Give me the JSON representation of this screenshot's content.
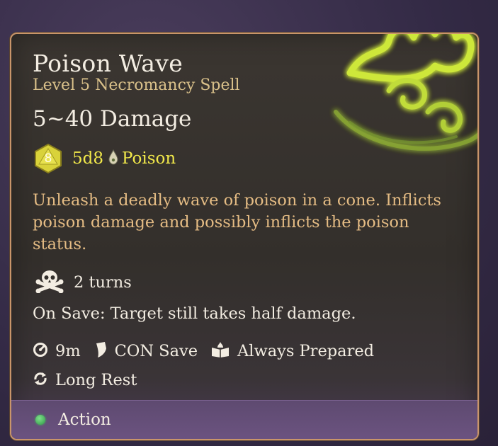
{
  "spell": {
    "name": "Poison Wave",
    "subtitle": "Level 5 Necromancy Spell",
    "damage": "5~40 Damage",
    "die_face": "8",
    "dice_expression": "5d8",
    "damage_type": "Poison",
    "description": "Unleash a deadly wave of poison in a cone. Inflicts poison damage and possibly inflicts the poison status.",
    "status_duration": "2 turns",
    "on_save": "On Save: Target still takes half damage.",
    "range": "9m",
    "save": "CON Save",
    "prepared": "Always Prepared",
    "recharge": "Long Rest",
    "cost": "Action"
  },
  "icons": {
    "emblem": "poison-wave-emblem-icon",
    "die": "d8-die-icon",
    "damage_type": "poison-drop-icon",
    "status": "skull-crossbones-icon",
    "range": "range-icon",
    "save": "shield-icon",
    "prepared": "spellbook-icon",
    "recharge": "recharge-icon",
    "cost": "action-dot-icon"
  },
  "colors": {
    "title": "#f3ede2",
    "subtitle": "#d9c08a",
    "damage_highlight": "#f1e84a",
    "description": "#e5bc84",
    "border": "#c9956a",
    "action_bar": "#6b5380",
    "action_dot": "#2f9a47",
    "emblem_glow": "#d4f53a"
  }
}
